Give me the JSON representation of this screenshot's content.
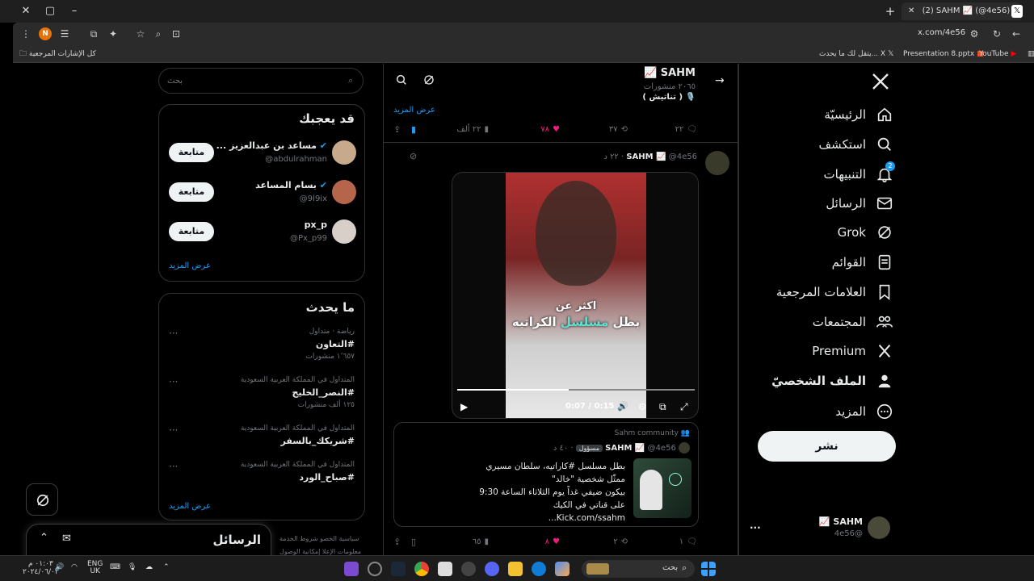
{
  "browser": {
    "tab_title": "(2) SAHM 📈 (@4e56) / X",
    "url": "x.com/4e56",
    "bookmarks": [
      {
        "label": "YouTube"
      },
      {
        "label": "Presentation 8.pptx"
      },
      {
        "label": "يتقل لك ما يحدث... X"
      },
      {
        "label": "كل الإشارات المرجعية"
      }
    ]
  },
  "nav": {
    "items": [
      {
        "label": "الرئيسيّة",
        "icon": "home-icon"
      },
      {
        "label": "استكشف",
        "icon": "search-icon"
      },
      {
        "label": "التنبيهات",
        "icon": "bell-icon",
        "badge": "2"
      },
      {
        "label": "الرسائل",
        "icon": "mail-icon"
      },
      {
        "label": "Grok",
        "icon": "grok-icon"
      },
      {
        "label": "القوائم",
        "icon": "list-icon"
      },
      {
        "label": "العلامات المرجعية",
        "icon": "bookmark-icon"
      },
      {
        "label": "المجتمعات",
        "icon": "communities-icon"
      },
      {
        "label": "Premium",
        "icon": "x-logo-icon"
      },
      {
        "label": "الملف الشخصيّ",
        "icon": "profile-icon"
      },
      {
        "label": "المزيد",
        "icon": "more-icon"
      }
    ],
    "post_button": "نشر",
    "account": {
      "name": "SAHM 📈",
      "handle": "@4e56",
      "menu": "..."
    }
  },
  "header": {
    "name": "SAHM 📈",
    "posts_count": "٢٠٦٥ منشورات",
    "bio_line": "🎙️ ( تناتيش )"
  },
  "prev_post": {
    "show_more": "عرض المزيد",
    "replies": "٢٢",
    "reposts": "٣٧",
    "likes": "٧٨",
    "views": "٢٢ ألف"
  },
  "post": {
    "name": "SAHM 📈",
    "handle": "@4e56",
    "time": "٢٢ د",
    "video": {
      "caption_top": "اكثر عن",
      "caption_main_pre": "بطل ",
      "caption_highlight": "مسلسل",
      "caption_main_post": " الكراتيه",
      "time": "0:07 / 0:15",
      "progress": 0.47
    },
    "quote": {
      "community": "Sahm community",
      "name": "SAHM 📈",
      "handle": "@4e56",
      "role": "مسؤول",
      "time": "٤٠ د",
      "lines": [
        "بطل مسلسل #كاراتيه، سلطان مسيري",
        "ممثّل شخصية  \"خالد\"",
        "بيكون ضيفي غداً يوم الثلاثاء الساعة 9:30",
        "على قناتي في الكيك",
        "Kick.com/ssahm..."
      ]
    },
    "replies": "١",
    "reposts": "٢",
    "likes": "٨",
    "views": "٦٥"
  },
  "search": {
    "placeholder": "بحث"
  },
  "who_to_follow": {
    "title": "قد يعجبك",
    "users": [
      {
        "name": "مساعد بن عبدالعزيز ...",
        "handle": "@abdulrahman",
        "button": "متابعة",
        "verified": true
      },
      {
        "name": "بسام المساعد",
        "handle": "@9l9ix",
        "button": "متابعة",
        "verified": true
      },
      {
        "name": "px_p",
        "handle": "@Px_p99",
        "button": "متابعة",
        "verified": false
      }
    ],
    "show_more": "عرض المزيد"
  },
  "trends": {
    "title": "ما يحدث",
    "items": [
      {
        "context": "رياضة · متداول",
        "name": "#التعاون",
        "count": "١٬٦٥٧ منشورات"
      },
      {
        "context": "المتداول في المملكة العربية السعودية",
        "name": "#النصر_الخليج",
        "count": "١٢٥ ألف منشورات"
      },
      {
        "context": "المتداول في المملكة العربية السعودية",
        "name": "#شريكك_بالسفر",
        "count": ""
      },
      {
        "context": "المتداول في المملكة العربية السعودية",
        "name": "#صباح_الورد",
        "count": ""
      }
    ],
    "show_more": "عرض المزيد"
  },
  "footer": {
    "line1a": "شروط الخدمة",
    "line1b": "سياسية الخصو",
    "line2a": "إمكانية الوصول",
    "line2b": "معلومات الإعلا"
  },
  "messages_drawer": {
    "title": "الرسائل"
  },
  "taskbar": {
    "search": "بحث",
    "lang": "ENG",
    "region": "UK",
    "time": "٠١:٠٣ م",
    "date": "٢٠٢٤/٠٦/٠٣"
  },
  "colors": {
    "accent": "#1d9bf0",
    "like": "#f91880",
    "bg": "#000000",
    "border": "#2f3336"
  }
}
